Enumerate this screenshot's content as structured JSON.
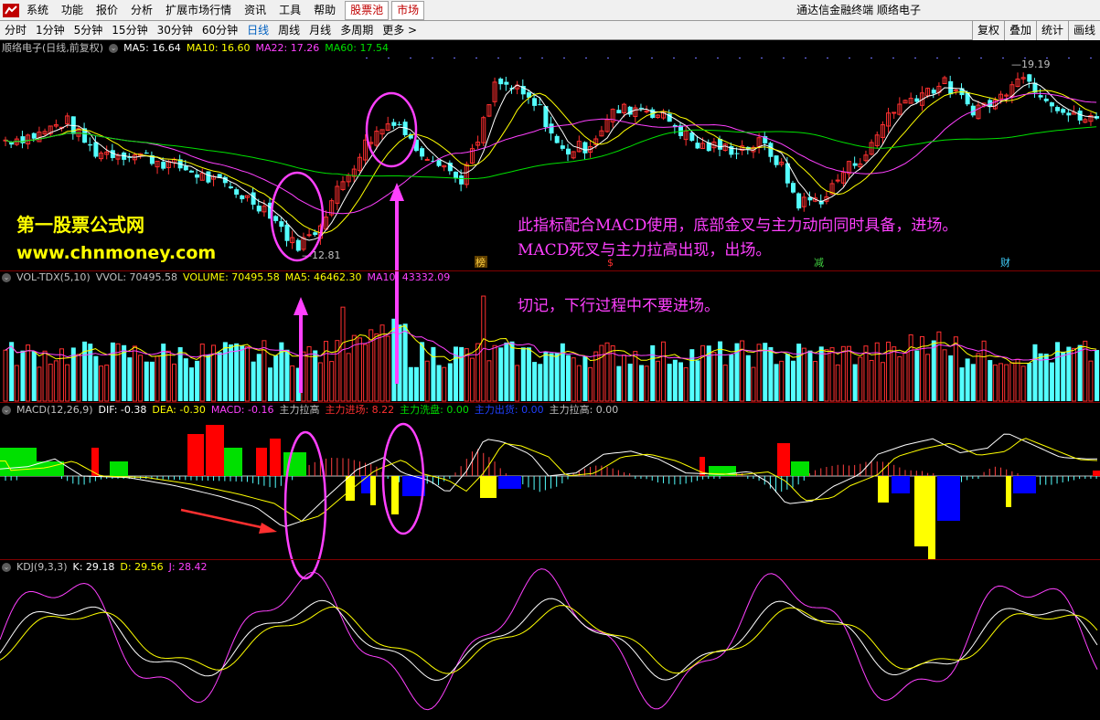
{
  "menu": [
    "系统",
    "功能",
    "报价",
    "分析",
    "扩展市场行情",
    "资讯",
    "工具",
    "帮助"
  ],
  "menu_boxed": [
    "股票池",
    "市场"
  ],
  "app_title": "通达信金融终端  顺络电子",
  "periods": [
    "分时",
    "1分钟",
    "5分钟",
    "15分钟",
    "30分钟",
    "60分钟",
    "日线",
    "周线",
    "月线",
    "多周期",
    "更多 >"
  ],
  "active_period": "日线",
  "toolbar_right": [
    "复权",
    "叠加",
    "统计",
    "画线"
  ],
  "main_panel": {
    "title": "顺络电子(日线,前复权)",
    "ma5": "MA5: 16.64",
    "ma10": "MA10: 16.60",
    "ma22": "MA22: 17.26",
    "ma60": "MA60: 17.54",
    "high_label": "19.19",
    "low_label": "12.81",
    "event_markers": [
      "榜",
      "$",
      "减",
      "财"
    ]
  },
  "vol_panel": {
    "title": "VOL-TDX(5,10)",
    "vvol": "VVOL: 70495.58",
    "volume": "VOLUME: 70495.58",
    "ma5": "MA5: 46462.30",
    "ma10": "MA10: 43332.09"
  },
  "macd_panel": {
    "title": "MACD(12,26,9)",
    "dif": "DIF: -0.38",
    "dea": "DEA: -0.30",
    "macd": "MACD: -0.16",
    "lbl1": "主力拉高",
    "lbl2": "主力进场: 8.22",
    "lbl3": "主力洗盘: 0.00",
    "lbl4": "主力出货: 0.00",
    "lbl5": "主力拉高: 0.00"
  },
  "kdj_panel": {
    "title": "KDJ(9,3,3)",
    "k": "K: 29.18",
    "d": "D: 29.56",
    "j": "J: 28.42"
  },
  "annotations": {
    "site_name": "第一股票公式网",
    "site_url": "www.chnmoney.com",
    "note_line1": "此指标配合MACD使用，底部金叉与主力动向同时具备，进场。",
    "note_line2": "MACD死叉与主力拉高出现，出场。",
    "note_line3": "切记，下行过程中不要进场。"
  },
  "colors": {
    "up": "#ff3030",
    "down": "#54ffff",
    "ma5": "#ffffff",
    "ma10": "#ffff00",
    "ma22": "#ff40ff",
    "ma60": "#00e000",
    "annotation": "#ff40ff",
    "site": "#ffff00",
    "macd_green": "#00e000",
    "macd_red": "#ff0000",
    "macd_yellow": "#ffff00",
    "macd_blue": "#0000ff"
  }
}
